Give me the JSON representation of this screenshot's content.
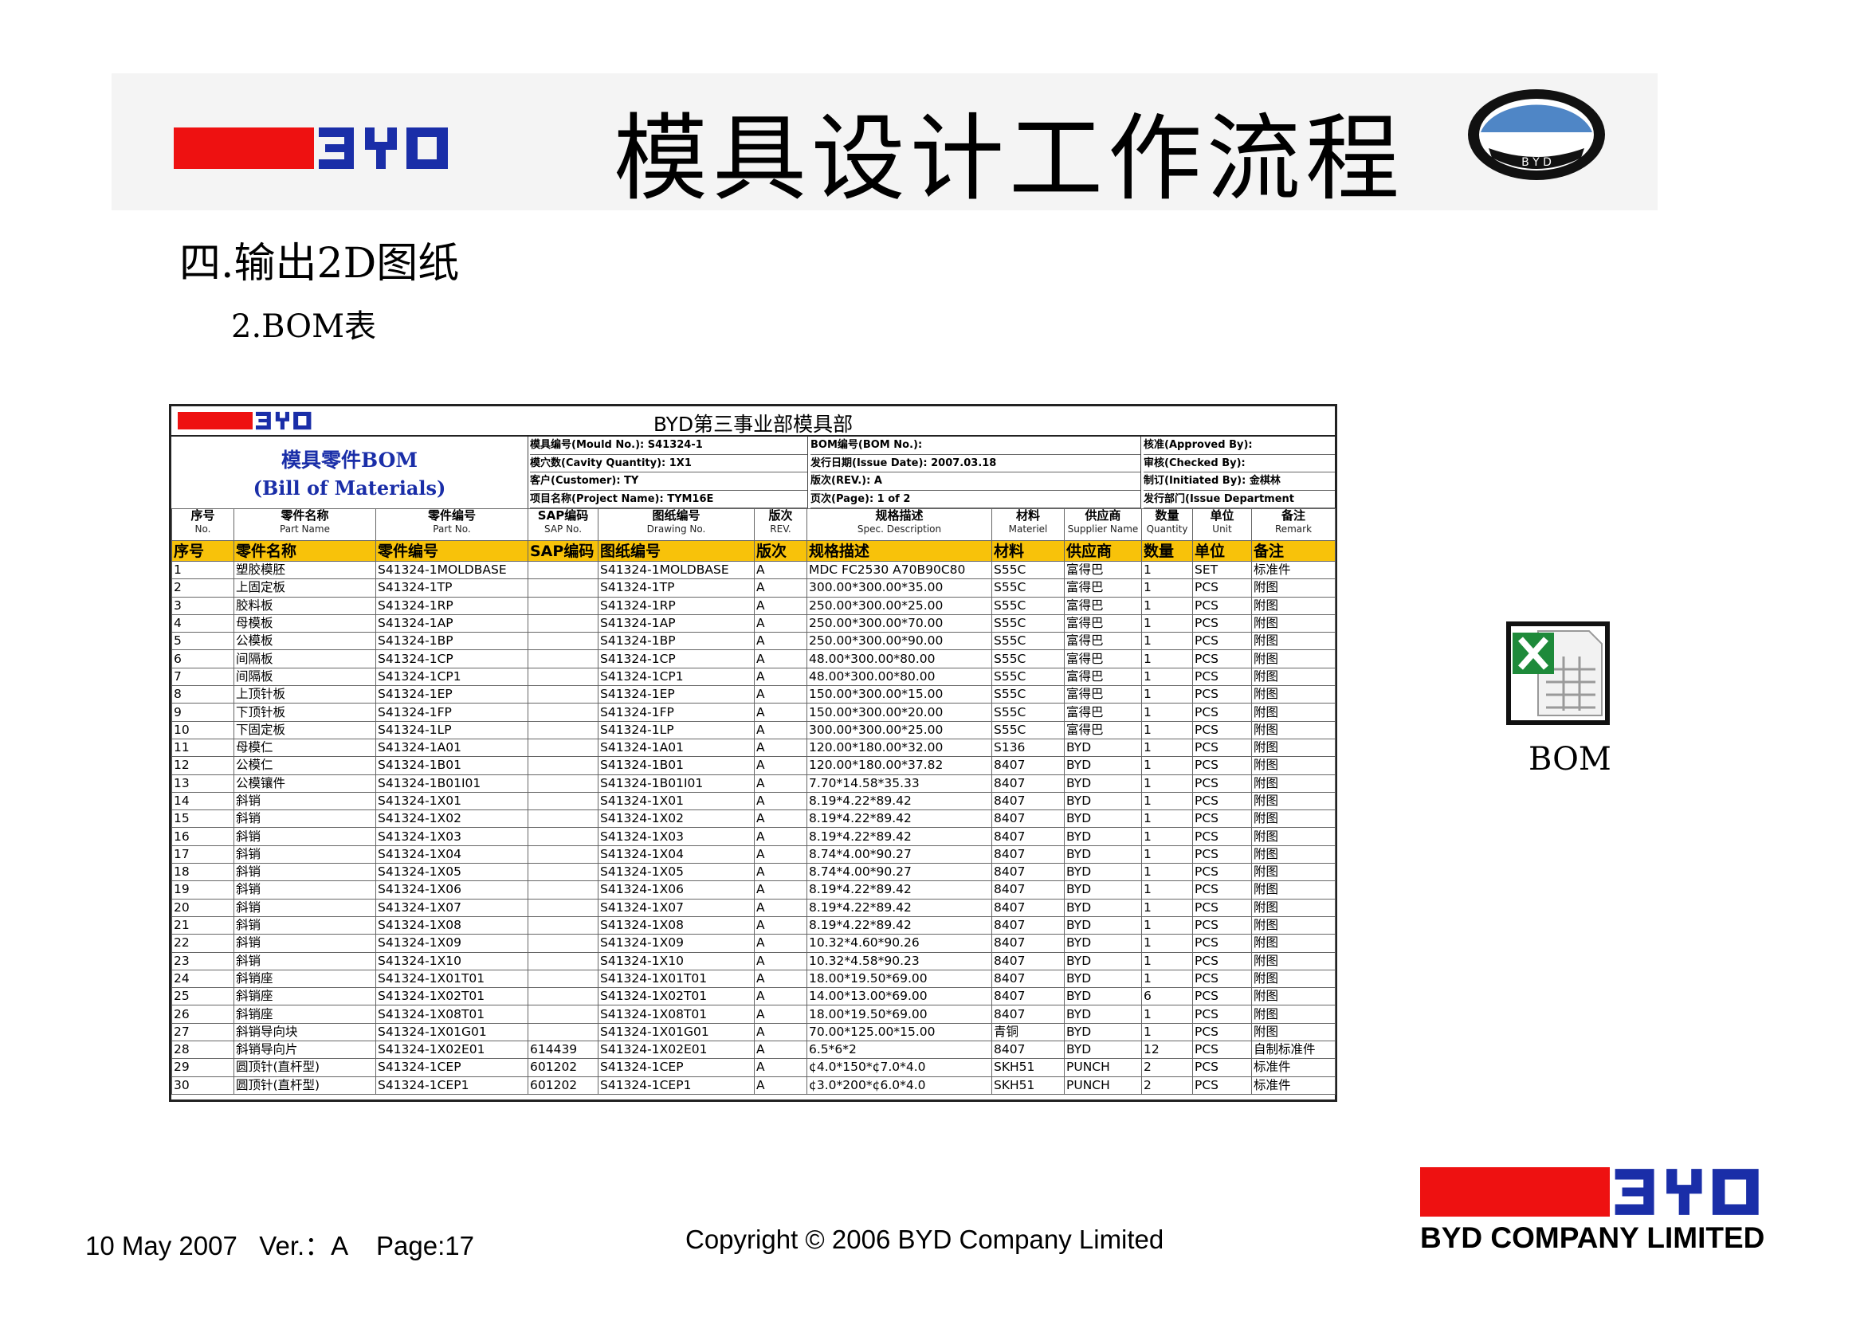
{
  "brand": {
    "logo_text": "BYD",
    "red": "#ee1111",
    "blue": "#1a2ea8",
    "oval_text": "B Y D"
  },
  "title": "模具设计工作流程",
  "section": "四.输出2D图纸",
  "subsection": "2.BOM表",
  "bom": {
    "sheet_title": "BYD第三事业部模具部",
    "heading_cn": "模具零件BOM",
    "heading_en": "(Bill  of  Materials)",
    "info_col1": [
      "模具编号(Mould No.): S41324-1",
      "模穴数(Cavity Quantity): 1X1",
      "客户(Customer): TY",
      "项目名称(Project Name): TYM16E"
    ],
    "info_col2": [
      "BOM编号(BOM No.):",
      "发行日期(Issue Date): 2007.03.18",
      "版次(REV.): A",
      "页次(Page):               1  of  2"
    ],
    "info_col3": [
      "核准(Approved By):",
      "审核(Checked By):",
      "制订(Initiated By): 金棋林",
      "发行部门(Issue Department"
    ],
    "columns": [
      {
        "cn": "序号",
        "en": "No."
      },
      {
        "cn": "零件名称",
        "en": "Part Name"
      },
      {
        "cn": "零件编号",
        "en": "Part No."
      },
      {
        "cn": "SAP编码",
        "en": "SAP No."
      },
      {
        "cn": "图纸编号",
        "en": "Drawing No."
      },
      {
        "cn": "版次",
        "en": "REV."
      },
      {
        "cn": "规格描述",
        "en": "Spec. Description"
      },
      {
        "cn": "材料",
        "en": "Materiel"
      },
      {
        "cn": "供应商",
        "en": "Supplier Name"
      },
      {
        "cn": "数量",
        "en": "Quantity"
      },
      {
        "cn": "单位",
        "en": "Unit"
      },
      {
        "cn": "备注",
        "en": "Remark"
      }
    ],
    "highlight_row": [
      "序号",
      "零件名称",
      "零件编号",
      "SAP编码",
      "图纸编号",
      "版次",
      "规格描述",
      "材料",
      "供应商",
      "数量",
      "单位",
      "备注"
    ],
    "rows": [
      [
        "1",
        "塑胶模胚",
        "S41324-1MOLDBASE",
        "",
        "S41324-1MOLDBASE",
        "A",
        "MDC FC2530 A70B90C80",
        "S55C",
        "富得巴",
        "1",
        "SET",
        "标准件"
      ],
      [
        "2",
        "上固定板",
        "S41324-1TP",
        "",
        "S41324-1TP",
        "A",
        "300.00*300.00*35.00",
        "S55C",
        "富得巴",
        "1",
        "PCS",
        "附图"
      ],
      [
        "3",
        "胶料板",
        "S41324-1RP",
        "",
        "S41324-1RP",
        "A",
        "250.00*300.00*25.00",
        "S55C",
        "富得巴",
        "1",
        "PCS",
        "附图"
      ],
      [
        "4",
        "母模板",
        "S41324-1AP",
        "",
        "S41324-1AP",
        "A",
        "250.00*300.00*70.00",
        "S55C",
        "富得巴",
        "1",
        "PCS",
        "附图"
      ],
      [
        "5",
        "公模板",
        "S41324-1BP",
        "",
        "S41324-1BP",
        "A",
        "250.00*300.00*90.00",
        "S55C",
        "富得巴",
        "1",
        "PCS",
        "附图"
      ],
      [
        "6",
        "间隔板",
        "S41324-1CP",
        "",
        "S41324-1CP",
        "A",
        "48.00*300.00*80.00",
        "S55C",
        "富得巴",
        "1",
        "PCS",
        "附图"
      ],
      [
        "7",
        "间隔板",
        "S41324-1CP1",
        "",
        "S41324-1CP1",
        "A",
        "48.00*300.00*80.00",
        "S55C",
        "富得巴",
        "1",
        "PCS",
        "附图"
      ],
      [
        "8",
        "上顶针板",
        "S41324-1EP",
        "",
        "S41324-1EP",
        "A",
        "150.00*300.00*15.00",
        "S55C",
        "富得巴",
        "1",
        "PCS",
        "附图"
      ],
      [
        "9",
        "下顶针板",
        "S41324-1FP",
        "",
        "S41324-1FP",
        "A",
        "150.00*300.00*20.00",
        "S55C",
        "富得巴",
        "1",
        "PCS",
        "附图"
      ],
      [
        "10",
        "下固定板",
        "S41324-1LP",
        "",
        "S41324-1LP",
        "A",
        "300.00*300.00*25.00",
        "S55C",
        "富得巴",
        "1",
        "PCS",
        "附图"
      ],
      [
        "11",
        "母模仁",
        "S41324-1A01",
        "",
        "S41324-1A01",
        "A",
        "120.00*180.00*32.00",
        "S136",
        "BYD",
        "1",
        "PCS",
        "附图"
      ],
      [
        "12",
        "公模仁",
        "S41324-1B01",
        "",
        "S41324-1B01",
        "A",
        "120.00*180.00*37.82",
        "8407",
        "BYD",
        "1",
        "PCS",
        "附图"
      ],
      [
        "13",
        "公模镶件",
        "S41324-1B01I01",
        "",
        "S41324-1B01I01",
        "A",
        "7.70*14.58*35.33",
        "8407",
        "BYD",
        "1",
        "PCS",
        "附图"
      ],
      [
        "14",
        "斜销",
        "S41324-1X01",
        "",
        "S41324-1X01",
        "A",
        "8.19*4.22*89.42",
        "8407",
        "BYD",
        "1",
        "PCS",
        "附图"
      ],
      [
        "15",
        "斜销",
        "S41324-1X02",
        "",
        "S41324-1X02",
        "A",
        "8.19*4.22*89.42",
        "8407",
        "BYD",
        "1",
        "PCS",
        "附图"
      ],
      [
        "16",
        "斜销",
        "S41324-1X03",
        "",
        "S41324-1X03",
        "A",
        "8.19*4.22*89.42",
        "8407",
        "BYD",
        "1",
        "PCS",
        "附图"
      ],
      [
        "17",
        "斜销",
        "S41324-1X04",
        "",
        "S41324-1X04",
        "A",
        "8.74*4.00*90.27",
        "8407",
        "BYD",
        "1",
        "PCS",
        "附图"
      ],
      [
        "18",
        "斜销",
        "S41324-1X05",
        "",
        "S41324-1X05",
        "A",
        "8.74*4.00*90.27",
        "8407",
        "BYD",
        "1",
        "PCS",
        "附图"
      ],
      [
        "19",
        "斜销",
        "S41324-1X06",
        "",
        "S41324-1X06",
        "A",
        "8.19*4.22*89.42",
        "8407",
        "BYD",
        "1",
        "PCS",
        "附图"
      ],
      [
        "20",
        "斜销",
        "S41324-1X07",
        "",
        "S41324-1X07",
        "A",
        "8.19*4.22*89.42",
        "8407",
        "BYD",
        "1",
        "PCS",
        "附图"
      ],
      [
        "21",
        "斜销",
        "S41324-1X08",
        "",
        "S41324-1X08",
        "A",
        "8.19*4.22*89.42",
        "8407",
        "BYD",
        "1",
        "PCS",
        "附图"
      ],
      [
        "22",
        "斜销",
        "S41324-1X09",
        "",
        "S41324-1X09",
        "A",
        "10.32*4.60*90.26",
        "8407",
        "BYD",
        "1",
        "PCS",
        "附图"
      ],
      [
        "23",
        "斜销",
        "S41324-1X10",
        "",
        "S41324-1X10",
        "A",
        "10.32*4.58*90.23",
        "8407",
        "BYD",
        "1",
        "PCS",
        "附图"
      ],
      [
        "24",
        "斜销座",
        "S41324-1X01T01",
        "",
        "S41324-1X01T01",
        "A",
        "18.00*19.50*69.00",
        "8407",
        "BYD",
        "1",
        "PCS",
        "附图"
      ],
      [
        "25",
        "斜销座",
        "S41324-1X02T01",
        "",
        "S41324-1X02T01",
        "A",
        "14.00*13.00*69.00",
        "8407",
        "BYD",
        "6",
        "PCS",
        "附图"
      ],
      [
        "26",
        "斜销座",
        "S41324-1X08T01",
        "",
        "S41324-1X08T01",
        "A",
        "18.00*19.50*69.00",
        "8407",
        "BYD",
        "1",
        "PCS",
        "附图"
      ],
      [
        "27",
        "斜销导向块",
        "S41324-1X01G01",
        "",
        "S41324-1X01G01",
        "A",
        "70.00*125.00*15.00",
        "青铜",
        "BYD",
        "1",
        "PCS",
        "附图"
      ],
      [
        "28",
        "斜销导向片",
        "S41324-1X02E01",
        "614439",
        "S41324-1X02E01",
        "A",
        "6.5*6*2",
        "8407",
        "BYD",
        "12",
        "PCS",
        "自制标准件"
      ],
      [
        "29",
        "圆顶针(直杆型)",
        "S41324-1CEP",
        "601202",
        "S41324-1CEP",
        "A",
        "¢4.0*150*¢7.0*4.0",
        "SKH51",
        "PUNCH",
        "2",
        "PCS",
        "标准件"
      ],
      [
        "30",
        "圆顶针(直杆型)",
        "S41324-1CEP1",
        "601202",
        "S41324-1CEP1",
        "A",
        "¢3.0*200*¢6.0*4.0",
        "SKH51",
        "PUNCH",
        "2",
        "PCS",
        "标准件"
      ]
    ]
  },
  "attachment": {
    "icon": "excel-file-icon",
    "label": "BOM"
  },
  "footer": {
    "date_ver_page": "10 May 2007   Ver.：A    Page:17",
    "copyright": "Copyright © 2006 BYD Company Limited",
    "company": "BYD COMPANY LIMITED"
  }
}
